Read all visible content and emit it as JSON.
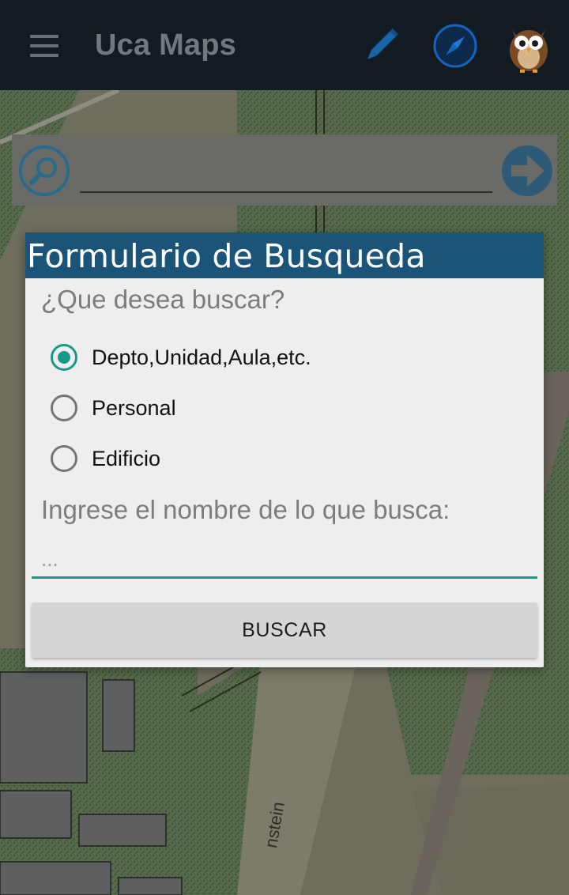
{
  "app_bar": {
    "menu_icon": "hamburger-menu-icon",
    "title": "Uca Maps",
    "actions": [
      {
        "icon": "pencil-icon",
        "color": "#1565a8"
      },
      {
        "icon": "compass-icon",
        "color": "#1565c0"
      },
      {
        "icon": "owl-avatar-icon"
      }
    ],
    "background": "#121a22"
  },
  "search_bar": {
    "search_icon": "magnifier-icon",
    "value": "",
    "go_icon": "arrow-right-icon",
    "accent": "#2a6a8c"
  },
  "dialog": {
    "title": "Formulario de Busqueda",
    "header_color": "#1b5479",
    "question": "¿Que desea buscar?",
    "options": [
      {
        "label": "Depto,Unidad,Aula,etc.",
        "checked": true
      },
      {
        "label": "Personal",
        "checked": false
      },
      {
        "label": "Edificio",
        "checked": false
      }
    ],
    "input_label": "Ingrese el nombre de lo que busca:",
    "input_placeholder": "...",
    "input_value": "",
    "accent": "#179a8a",
    "submit_label": "BUSCAR"
  },
  "map": {
    "street_label": "nstein"
  }
}
